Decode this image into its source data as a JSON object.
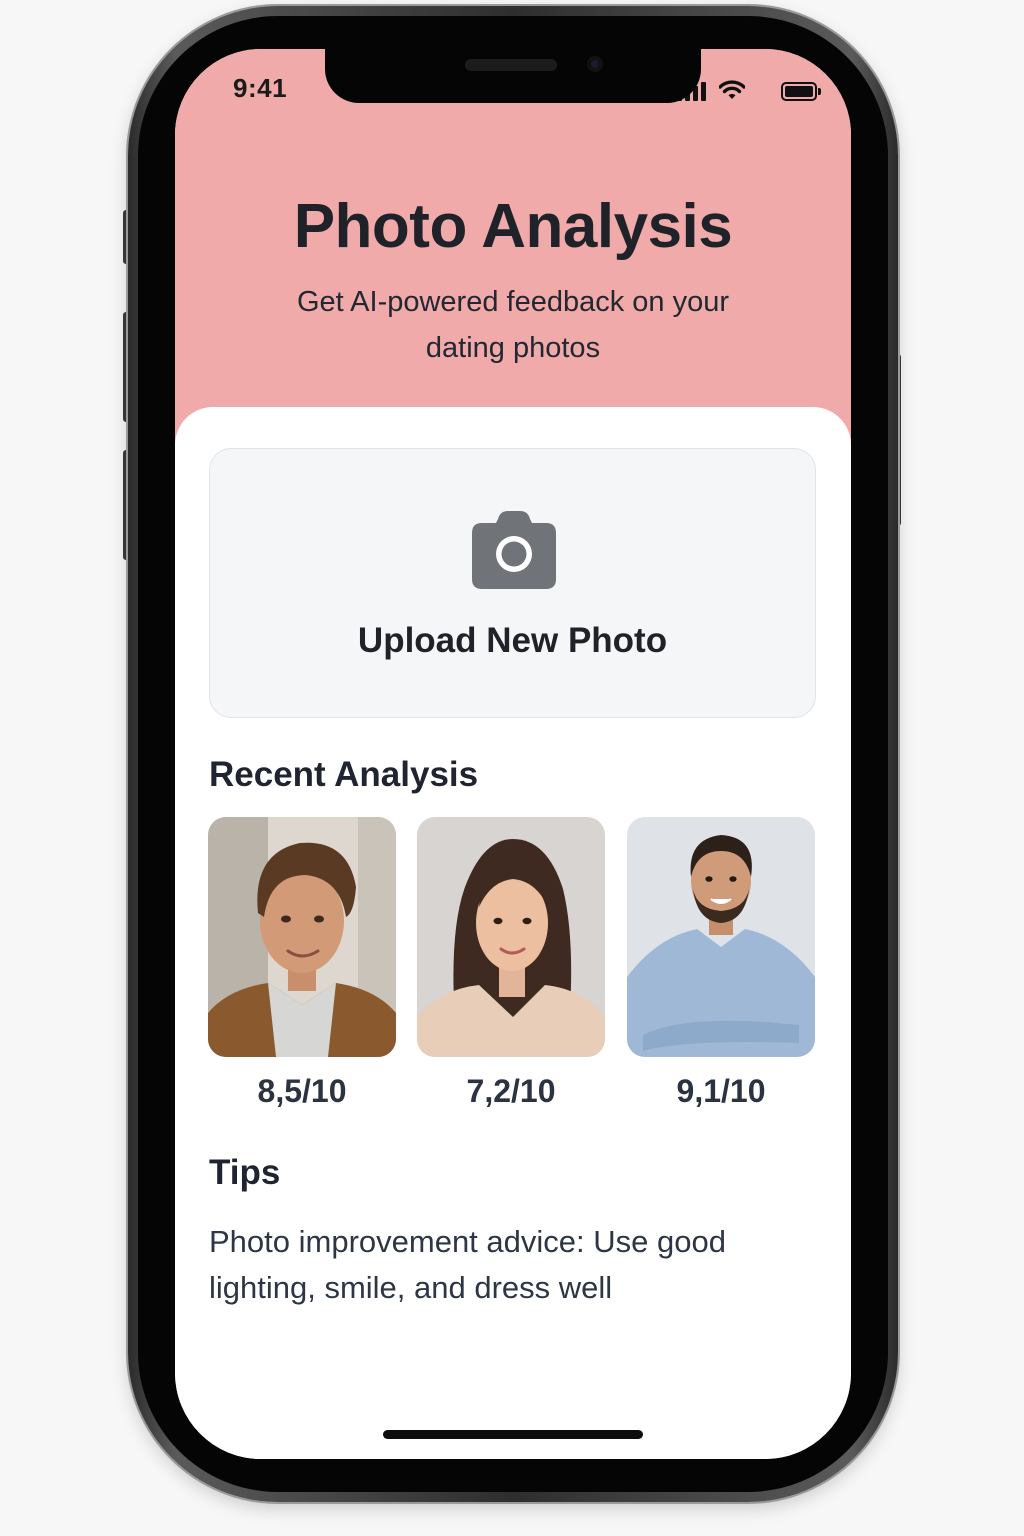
{
  "status_bar": {
    "time": "9:41",
    "icons": [
      "signal-icon",
      "wifi-icon",
      "battery-icon"
    ]
  },
  "header": {
    "title": "Photo Analysis",
    "subtitle": "Get AI-powered feedback on your dating photos",
    "background_color": "#f0aaaa"
  },
  "upload": {
    "icon": "camera-icon",
    "label": "Upload New Photo"
  },
  "recent": {
    "title": "Recent Analysis",
    "items": [
      {
        "score": "8,5/10",
        "image": "portrait-man-brown-jacket"
      },
      {
        "score": "7,2/10",
        "image": "portrait-woman-long-hair"
      },
      {
        "score": "9,1/10",
        "image": "portrait-man-blue-shirt"
      }
    ]
  },
  "tips": {
    "title": "Tips",
    "text": "Photo improvement advice: Use good lighting, smile, and dress well"
  }
}
